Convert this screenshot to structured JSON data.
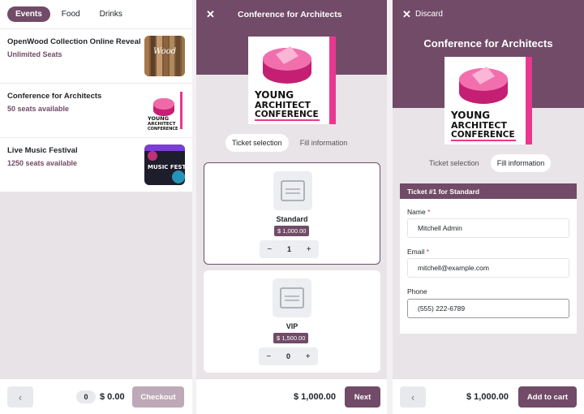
{
  "screen1": {
    "tabs": [
      "Events",
      "Food",
      "Drinks"
    ],
    "events": [
      {
        "title": "OpenWood Collection Online Reveal",
        "seats": "Unlimited Seats"
      },
      {
        "title": "Conference for Architects",
        "seats": "50 seats available"
      },
      {
        "title": "Live Music Festival",
        "seats": "1250 seats available"
      }
    ],
    "thumbs": {
      "wood": "Wood",
      "music": "MUSIC FEST"
    },
    "footer": {
      "back_icon": "chevron-left-icon",
      "count": "0",
      "total": "$ 0.00",
      "checkout": "Checkout"
    }
  },
  "poster": {
    "line1": "YOUNG",
    "line2": "ARCHITECT",
    "line3": "CONFERENCE"
  },
  "screen2": {
    "close_icon": "close-icon",
    "title": "Conference for Architects",
    "segments": [
      "Ticket selection",
      "Fill information"
    ],
    "tickets": [
      {
        "name": "Standard",
        "price": "$ 1,000.00",
        "qty": "1"
      },
      {
        "name": "VIP",
        "price": "$ 1,500.00",
        "qty": "0"
      }
    ],
    "stepper": {
      "minus": "−",
      "plus": "+"
    },
    "footer": {
      "total": "$ 1,000.00",
      "next": "Next"
    }
  },
  "screen3": {
    "discard": "Discard",
    "title": "Conference for Architects",
    "segments": [
      "Ticket selection",
      "Fill information"
    ],
    "form": {
      "heading": "Ticket #1 for Standard",
      "name_label": "Name",
      "name_value": "Mitchell Admin",
      "email_label": "Email",
      "email_value": "mitchell@example.com",
      "phone_label": "Phone",
      "phone_value": "(555) 222-6789",
      "required_mark": "*"
    },
    "footer": {
      "total": "$ 1,000.00",
      "add": "Add to cart"
    }
  },
  "colors": {
    "brand": "#714b67",
    "poster_pink": "#e8378f"
  }
}
